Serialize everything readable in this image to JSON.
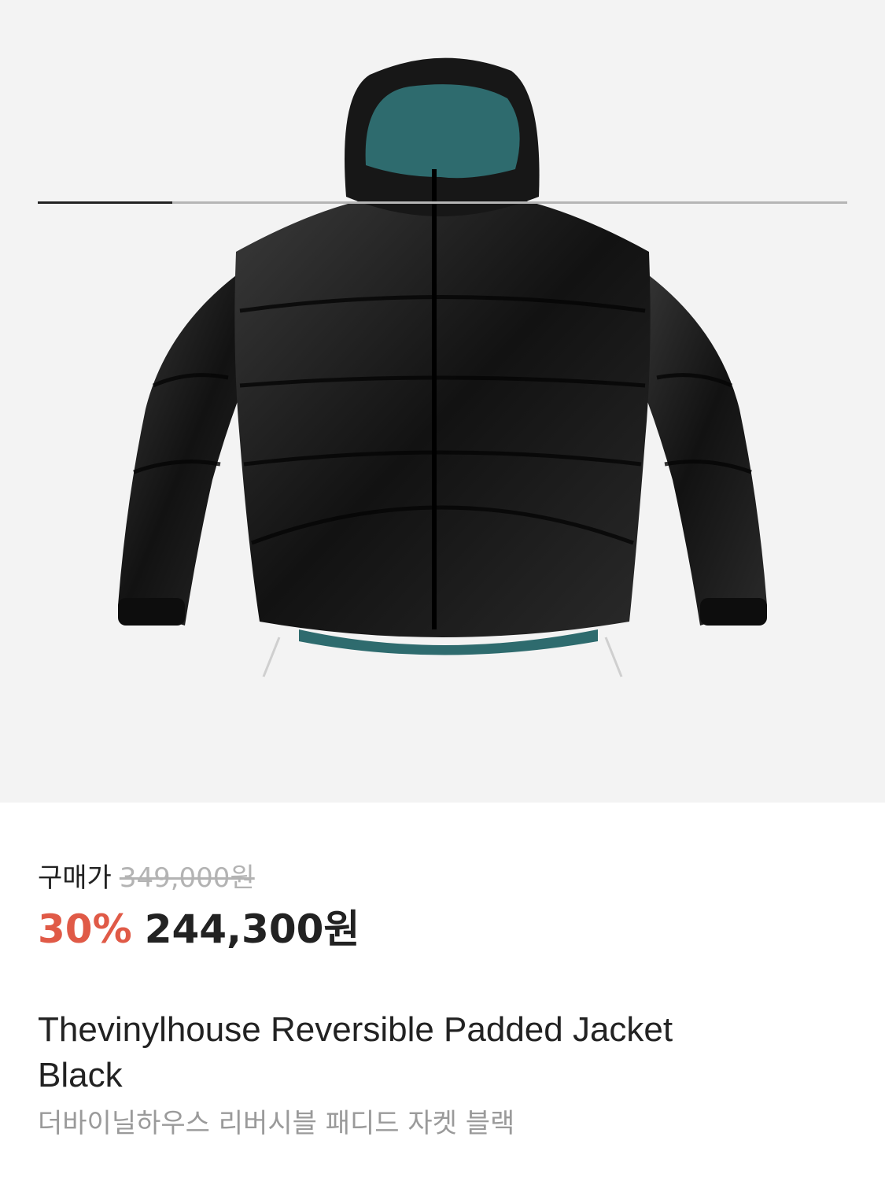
{
  "gallery": {
    "image_alt": "Black reversible padded hooded jacket with teal lining",
    "progress": 0.166,
    "colors": {
      "background": "#f3f3f3",
      "jacket": "#161616",
      "lining": "#2e6b6e"
    }
  },
  "price": {
    "label": "구매가",
    "original": "349,000원",
    "discount": "30%",
    "sale": "244,300원"
  },
  "product": {
    "title": "Thevinylhouse Reversible Padded Jacket Black",
    "subtitle_ko": "더바이닐하우스 리버시블 패디드 자켓 블랙"
  }
}
